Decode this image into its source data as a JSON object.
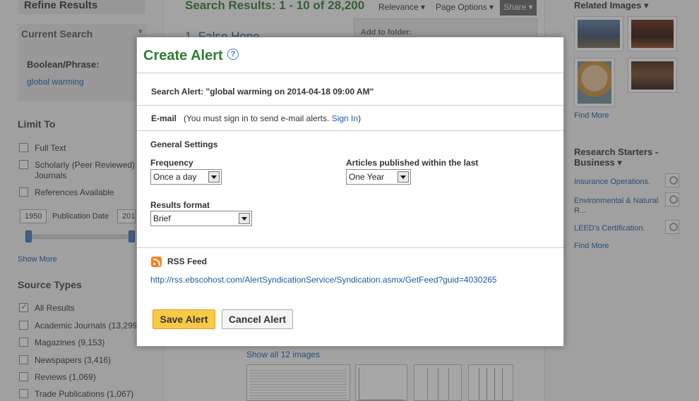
{
  "background": {
    "left": {
      "refine_results": "Refine Results",
      "current_search": "Current Search",
      "boolean_phrase_label": "Boolean/Phrase:",
      "boolean_phrase_value": "global warming",
      "limit_to": "Limit To",
      "limits": [
        {
          "label": "Full Text",
          "checked": false
        },
        {
          "label": "Scholarly (Peer Reviewed) Journals",
          "checked": false
        },
        {
          "label": "References Available",
          "checked": false
        }
      ],
      "year_from": "1950",
      "publication_date": "Publication Date",
      "year_to": "201",
      "show_more": "Show More",
      "source_types": "Source Types",
      "sources": [
        {
          "label": "All Results",
          "checked": true
        },
        {
          "label": "Academic Journals (13,299",
          "checked": false
        },
        {
          "label": "Magazines (9,153)",
          "checked": false
        },
        {
          "label": "Newspapers (3,416)",
          "checked": false
        },
        {
          "label": "Reviews (1,069)",
          "checked": false
        },
        {
          "label": "Trade Publications (1,067)",
          "checked": false
        }
      ]
    },
    "middle": {
      "results_heading": "Search Results: 1 - 10 of 28,200",
      "relevance": "Relevance",
      "page_options": "Page Options",
      "share": "Share",
      "add_to_folder": "Add to folder:",
      "first_result_title": "1. False Hope",
      "show_all_images": "Show all 12 images"
    },
    "right": {
      "related_images": "Related Images",
      "find_more": "Find More",
      "research_starters": "Research Starters - Business",
      "starters": [
        "Insurance Operations.",
        "Environmental & Natural R...",
        "LEED's Certification."
      ],
      "find_more_2": "Find More"
    }
  },
  "modal": {
    "title": "Create Alert",
    "help_glyph": "?",
    "search_alert": "Search Alert: \"global warming on 2014-04-18 09:00 AM\"",
    "email_label": "E-mail",
    "email_note": "(You must sign in to send e-mail alerts.",
    "sign_in": "Sign In",
    "email_close": ")",
    "general_settings": "General Settings",
    "frequency_label": "Frequency",
    "frequency_value": "Once a day",
    "articles_label": "Articles published within the last",
    "articles_value": "One Year",
    "results_format_label": "Results format",
    "results_format_value": "Brief",
    "rss_feed": "RSS Feed",
    "rss_url": "http://rss.ebscohost.com/AlertSyndicationService/Syndication.asmx/GetFeed?guid=4030265",
    "save_button": "Save Alert",
    "cancel_button": "Cancel Alert"
  },
  "colors": {
    "title_green": "#2e7d32",
    "link_blue": "#1a5da6",
    "save_yellow": "#f9c846",
    "rss_orange": "#f58220"
  }
}
